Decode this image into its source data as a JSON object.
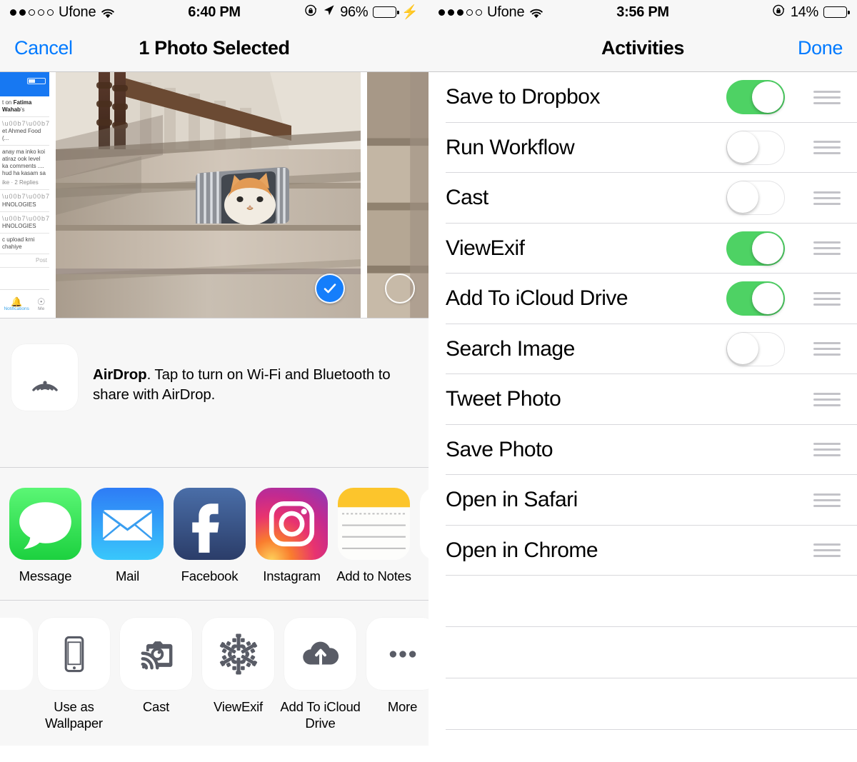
{
  "left": {
    "status": {
      "signal_filled": 2,
      "signal_total": 5,
      "carrier": "Ufone",
      "wifi_icon": "wifi-icon",
      "time": "6:40 PM",
      "rotation_lock_icon": "rotation-lock-icon",
      "location_icon": "location-arrow-icon",
      "battery_pct": "96%",
      "battery_color": "#4cd964",
      "charging_icon": "⚡"
    },
    "nav": {
      "cancel_label": "Cancel",
      "title": "1 Photo Selected"
    },
    "thumb_feed": {
      "battery_label": "37%",
      "line1_pre": "t on ",
      "line1_bold": "Fatima Wahab",
      "line1_post": "'s",
      "line2": "et Ahmed Food (...",
      "line3": "anay ma inko koi atiraz ook level ka comments .... hud ha kasam sa",
      "line4": "ike  ·  2 Replies",
      "line5": "HNOLOGIES",
      "line6": "HNOLOGIES",
      "line7": "c upload krni chahiye",
      "post_label": "Post",
      "tab1": "Notifications",
      "tab2": "Me"
    },
    "photo": {
      "selected_icon": "checkmark-icon",
      "unselected_icon": "empty-circle-icon"
    },
    "airdrop": {
      "icon": "airdrop-icon",
      "name": "AirDrop",
      "description": ". Tap to turn on Wi-Fi and Bluetooth to share with AirDrop."
    },
    "share_apps": [
      {
        "label": "Message",
        "icon": "message-bubble-icon"
      },
      {
        "label": "Mail",
        "icon": "mail-envelope-icon"
      },
      {
        "label": "Facebook",
        "icon": "facebook-icon"
      },
      {
        "label": "Instagram",
        "icon": "instagram-icon"
      },
      {
        "label": "Add to Notes",
        "icon": "notes-icon"
      }
    ],
    "actions": [
      {
        "label": "Use as Wallpaper",
        "icon": "phone-wallpaper-icon"
      },
      {
        "label": "Cast",
        "icon": "cast-camera-icon"
      },
      {
        "label": "ViewExif",
        "icon": "snowflake-icon"
      },
      {
        "label": "Add To iCloud Drive",
        "icon": "icloud-upload-icon"
      },
      {
        "label": "More",
        "icon": "more-dots-icon"
      }
    ]
  },
  "right": {
    "status": {
      "signal_filled": 3,
      "signal_total": 5,
      "carrier": "Ufone",
      "wifi_icon": "wifi-icon",
      "time": "3:56 PM",
      "rotation_lock_icon": "rotation-lock-icon",
      "battery_pct": "14%",
      "battery_color": "#ff3b30"
    },
    "nav": {
      "title": "Activities",
      "done_label": "Done"
    },
    "activities": [
      {
        "label": "Save to Dropbox",
        "toggle": "on",
        "handle_icon": "reorder-handle-icon"
      },
      {
        "label": "Run Workflow",
        "toggle": "off",
        "handle_icon": "reorder-handle-icon"
      },
      {
        "label": "Cast",
        "toggle": "off",
        "handle_icon": "reorder-handle-icon"
      },
      {
        "label": "ViewExif",
        "toggle": "on",
        "handle_icon": "reorder-handle-icon"
      },
      {
        "label": "Add To iCloud Drive",
        "toggle": "on",
        "handle_icon": "reorder-handle-icon"
      },
      {
        "label": "Search Image",
        "toggle": "off",
        "handle_icon": "reorder-handle-icon"
      },
      {
        "label": "Tweet Photo",
        "toggle": "none",
        "handle_icon": "reorder-handle-icon"
      },
      {
        "label": "Save Photo",
        "toggle": "none",
        "handle_icon": "reorder-handle-icon"
      },
      {
        "label": "Open in Safari",
        "toggle": "none",
        "handle_icon": "reorder-handle-icon"
      },
      {
        "label": "Open in Chrome",
        "toggle": "none",
        "handle_icon": "reorder-handle-icon"
      }
    ],
    "empty_rows": 3
  },
  "colors": {
    "accent_blue": "#007aff",
    "toggle_green": "#4ed264",
    "select_blue": "#157efb",
    "bar_bg": "#f7f7f7",
    "separator": "#d8d8dc"
  }
}
